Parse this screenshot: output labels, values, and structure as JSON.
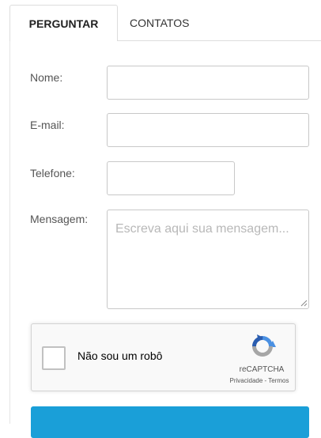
{
  "tabs": {
    "active": "PERGUNTAR",
    "inactive": "CONTATOS"
  },
  "form": {
    "name_label": "Nome:",
    "name_value": "",
    "email_label": "E-mail:",
    "email_value": "",
    "phone_label": "Telefone:",
    "phone_value": "",
    "message_label": "Mensagem:",
    "message_placeholder": "Escreva aqui sua mensagem...",
    "message_value": ""
  },
  "captcha": {
    "checkbox_label": "Não sou um robô",
    "checked": false,
    "brand": "reCAPTCHA",
    "terms": "Privacidade - Termos",
    "logo_icon": "recaptcha-logo-icon"
  },
  "colors": {
    "accent": "#1a9fd8",
    "captcha_blue": "#4a90e2",
    "captcha_gray": "#a6a6a6"
  }
}
